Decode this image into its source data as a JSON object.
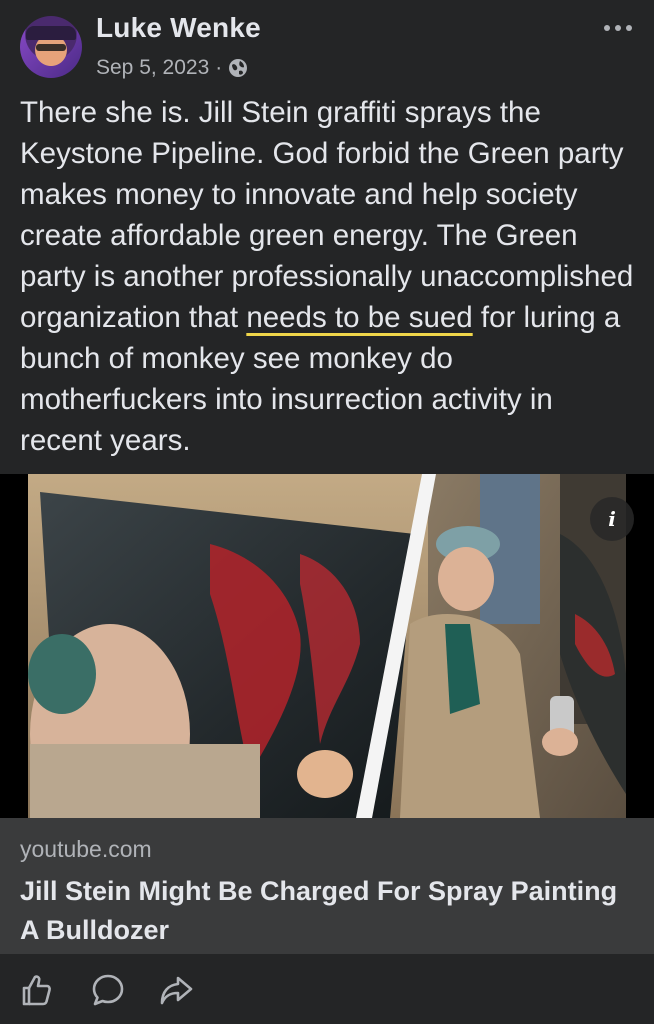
{
  "post": {
    "author": "Luke Wenke",
    "date": "Sep 5, 2023",
    "separator": "·",
    "privacy_icon": "globe-icon",
    "text": {
      "part1": "There she is.  Jill Stein graffiti sprays the Keystone Pipeline.  God forbid the Green party makes money to innovate and help society create affordable green energy.  The Green party is another professionally unaccomplished organization that ",
      "underlined": "needs to be sued",
      "part2": " for luring a bunch of monkey see monkey do motherfuckers into insurrection activity in recent years."
    }
  },
  "link_preview": {
    "domain": "youtube.com",
    "title": "Jill Stein Might Be Charged For Spray Painting A Bulldozer",
    "info_icon": "info-icon"
  },
  "actions": [
    "like-icon",
    "comment-icon",
    "share-icon"
  ],
  "colors": {
    "background": "#242526",
    "card": "#3a3b3c",
    "text": "#e4e6eb",
    "secondary": "#b0b3b8",
    "highlight": "#f0d64a"
  }
}
